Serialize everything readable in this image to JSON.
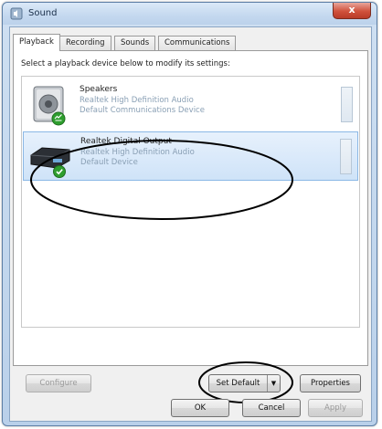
{
  "window": {
    "title": "Sound",
    "close_glyph": "x"
  },
  "tabs": [
    {
      "label": "Playback",
      "active": true
    },
    {
      "label": "Recording",
      "active": false
    },
    {
      "label": "Sounds",
      "active": false
    },
    {
      "label": "Communications",
      "active": false
    }
  ],
  "panel": {
    "instruction": "Select a playback device below to modify its settings:"
  },
  "devices": [
    {
      "name": "Speakers",
      "line1": "Realtek High Definition Audio",
      "line2": "Default Communications Device",
      "icon": "speaker-icon",
      "selected": false
    },
    {
      "name": "Realtek Digital Output",
      "line1": "Realtek High Definition Audio",
      "line2": "Default Device",
      "icon": "digital-output-icon",
      "selected": true
    }
  ],
  "buttons": {
    "configure": "Configure",
    "set_default": "Set Default",
    "set_default_arrow": "▼",
    "properties": "Properties",
    "ok": "OK",
    "cancel": "Cancel",
    "apply": "Apply"
  },
  "colors": {
    "selection_border": "#8bb8e6",
    "annotation": "#000000",
    "default_check": "#2e9e2e"
  }
}
